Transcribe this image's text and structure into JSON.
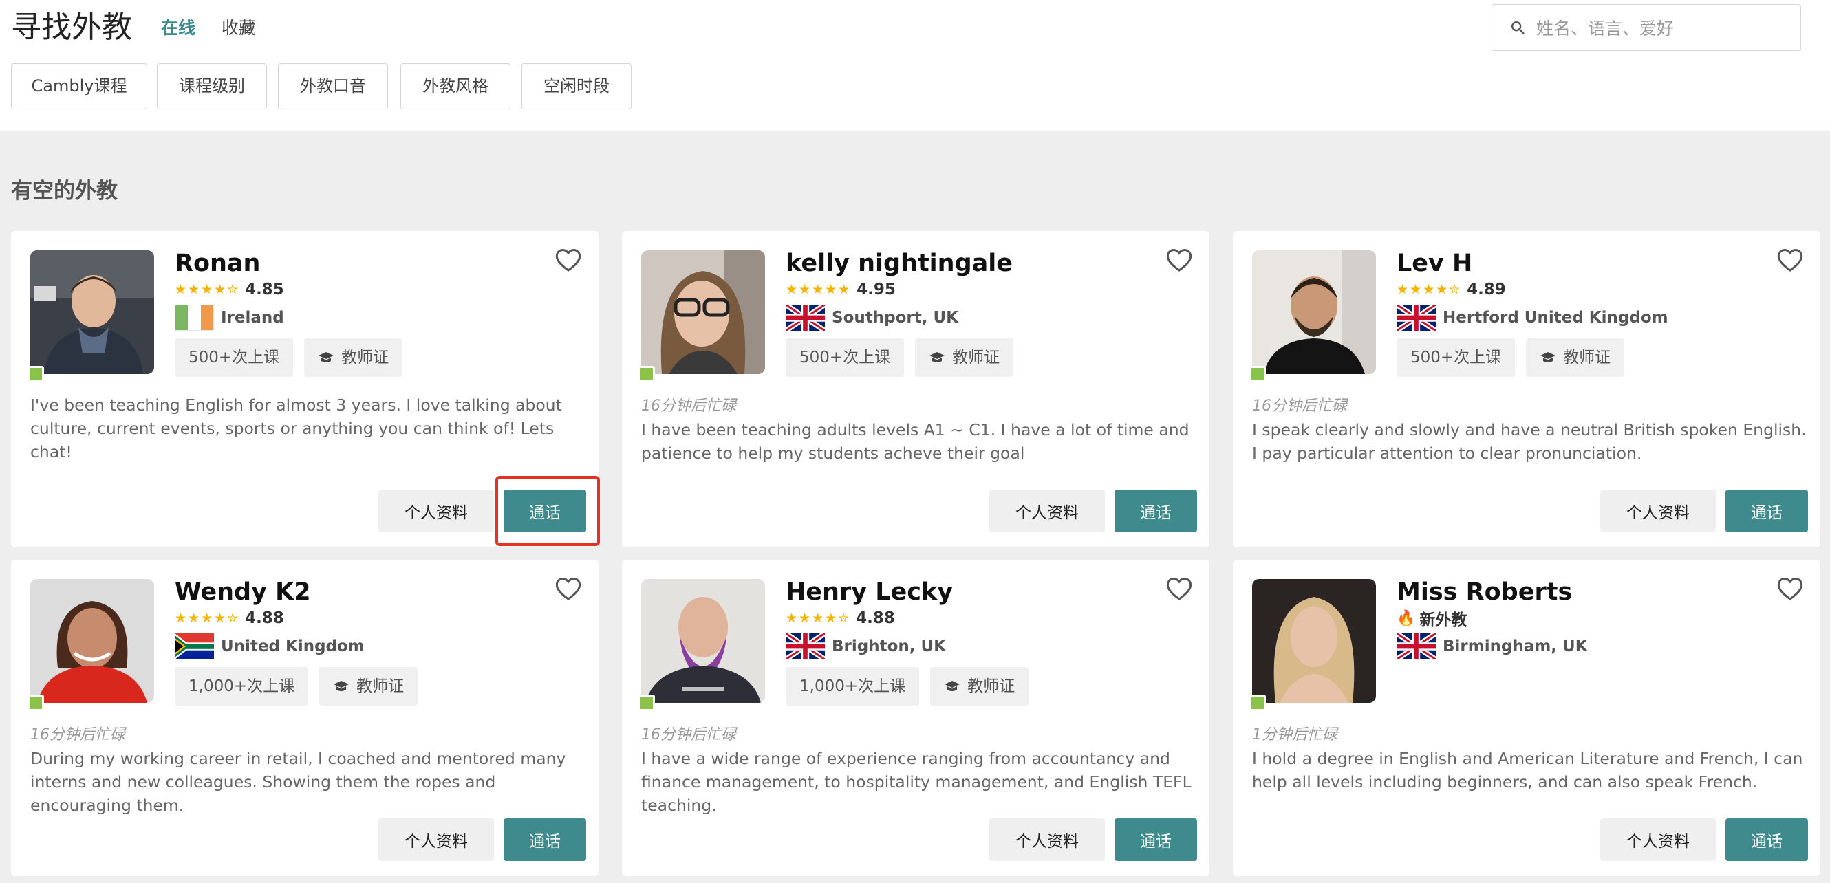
{
  "header": {
    "title": "寻找外教",
    "tabs": [
      {
        "label": "在线",
        "active": true
      },
      {
        "label": "收藏",
        "active": false
      }
    ],
    "search": {
      "placeholder": "姓名、语言、爱好",
      "value": "",
      "icon": "search-icon"
    }
  },
  "filters": [
    "Cambly课程",
    "课程级别",
    "外教口音",
    "外教风格",
    "空闲时段"
  ],
  "section_title": "有空的外教",
  "colors": {
    "accent": "#3f8a8c",
    "online": "#8bc34a",
    "star": "#f3b300",
    "highlight": "#e53224"
  },
  "tutors": [
    {
      "name": "Ronan",
      "stars": "★★★★✮",
      "rating": "4.85",
      "is_new": false,
      "flag": "ireland",
      "location": "Ireland",
      "lessons": "500+次上课",
      "certificate": "教师证",
      "busy": "",
      "description": "I've been teaching English for almost 3 years. I love talking about culture, current events, sports or anything you can think of! Lets chat!",
      "profile_label": "个人资料",
      "call_label": "通话"
    },
    {
      "name": "kelly nightingale",
      "stars": "★★★★★",
      "rating": "4.95",
      "is_new": false,
      "flag": "uk",
      "location": "Southport, UK",
      "lessons": "500+次上课",
      "certificate": "教师证",
      "busy": "16分钟后忙碌",
      "description": "I have been teaching adults levels A1 ~ C1. I have a lot of time and patience to help my students acheve their goal",
      "profile_label": "个人资料",
      "call_label": "通话"
    },
    {
      "name": "Lev H",
      "stars": "★★★★✮",
      "rating": "4.89",
      "is_new": false,
      "flag": "uk",
      "location": "Hertford United Kingdom",
      "lessons": "500+次上课",
      "certificate": "教师证",
      "busy": "16分钟后忙碌",
      "description": "I speak clearly and slowly and have a neutral British spoken English. I pay particular attention to clear pronunciation.",
      "profile_label": "个人资料",
      "call_label": "通话"
    },
    {
      "name": "Wendy K2",
      "stars": "★★★★✮",
      "rating": "4.88",
      "is_new": false,
      "flag": "south-africa",
      "location": "United Kingdom",
      "lessons": "1,000+次上课",
      "certificate": "教师证",
      "busy": "16分钟后忙碌",
      "description": "During my working career in retail, I coached and mentored many interns and new colleagues. Showing them the ropes and encouraging them.",
      "profile_label": "个人资料",
      "call_label": "通话"
    },
    {
      "name": "Henry Lecky",
      "stars": "★★★★✮",
      "rating": "4.88",
      "is_new": false,
      "flag": "uk",
      "location": "Brighton, UK",
      "lessons": "1,000+次上课",
      "certificate": "教师证",
      "busy": "16分钟后忙碌",
      "description": "I have a wide range of experience ranging from accountancy and finance management, to hospitality management, and English TEFL teaching.",
      "profile_label": "个人资料",
      "call_label": "通话"
    },
    {
      "name": "Miss Roberts",
      "stars": "",
      "rating": "",
      "is_new": true,
      "new_label": "新外教",
      "flag": "uk",
      "location": "Birmingham, UK",
      "lessons": "",
      "certificate": "",
      "busy": "1分钟后忙碌",
      "description": "I hold a degree in English and American Literature and French, I can help all levels including beginners, and can also speak French.",
      "profile_label": "个人资料",
      "call_label": "通话"
    }
  ]
}
